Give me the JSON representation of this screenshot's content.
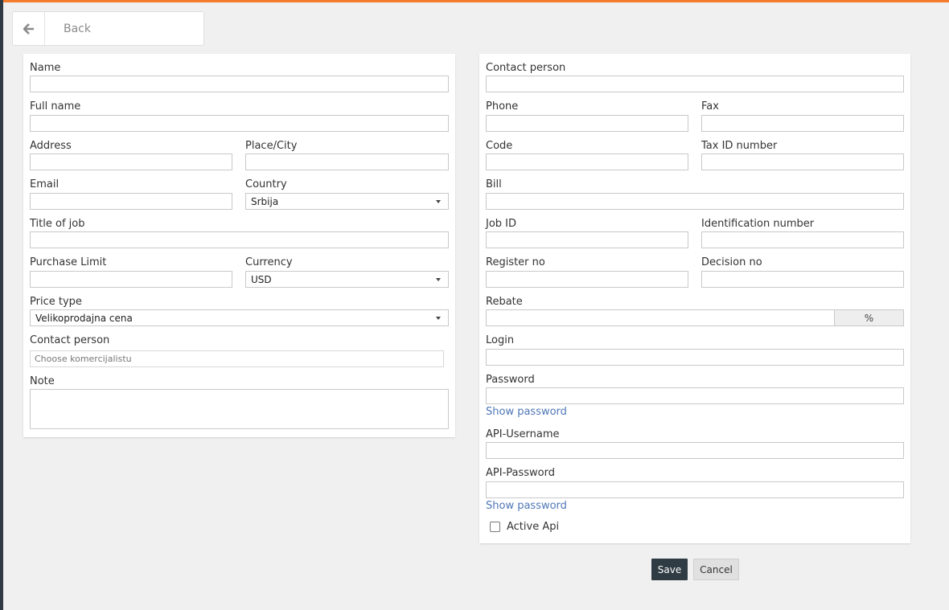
{
  "colors": {
    "accent": "#f47c2c",
    "link": "#4f77b7",
    "save_button": "#2f3c44"
  },
  "back": {
    "icon": "arrow-left-icon",
    "label": "Back"
  },
  "left": {
    "name_label": "Name",
    "full_name_label": "Full name",
    "address_label": "Address",
    "place_city_label": "Place/City",
    "email_label": "Email",
    "country_label": "Country",
    "country_value": "Srbija",
    "title_of_job_label": "Title of job",
    "purchase_limit_label": "Purchase Limit",
    "currency_label": "Currency",
    "currency_value": "USD",
    "price_type_label": "Price type",
    "price_type_value": "Velikoprodajna cena",
    "contact_person_label": "Contact person",
    "contact_person_placeholder": "Choose komercijalistu",
    "note_label": "Note"
  },
  "right": {
    "contact_person_label": "Contact person",
    "phone_label": "Phone",
    "fax_label": "Fax",
    "code_label": "Code",
    "tax_id_label": "Tax ID number",
    "bill_label": "Bill",
    "job_id_label": "Job ID",
    "identification_number_label": "Identification number",
    "register_no_label": "Register no",
    "decision_no_label": "Decision no",
    "rebate_label": "Rebate",
    "rebate_addon": "%",
    "login_label": "Login",
    "password_label": "Password",
    "show_password_1": "Show password",
    "api_username_label": "API-Username",
    "api_password_label": "API-Password",
    "show_password_2": "Show password",
    "active_api_label": "Active Api",
    "active_api_checked": false
  },
  "actions": {
    "save_label": "Save",
    "cancel_label": "Cancel"
  }
}
